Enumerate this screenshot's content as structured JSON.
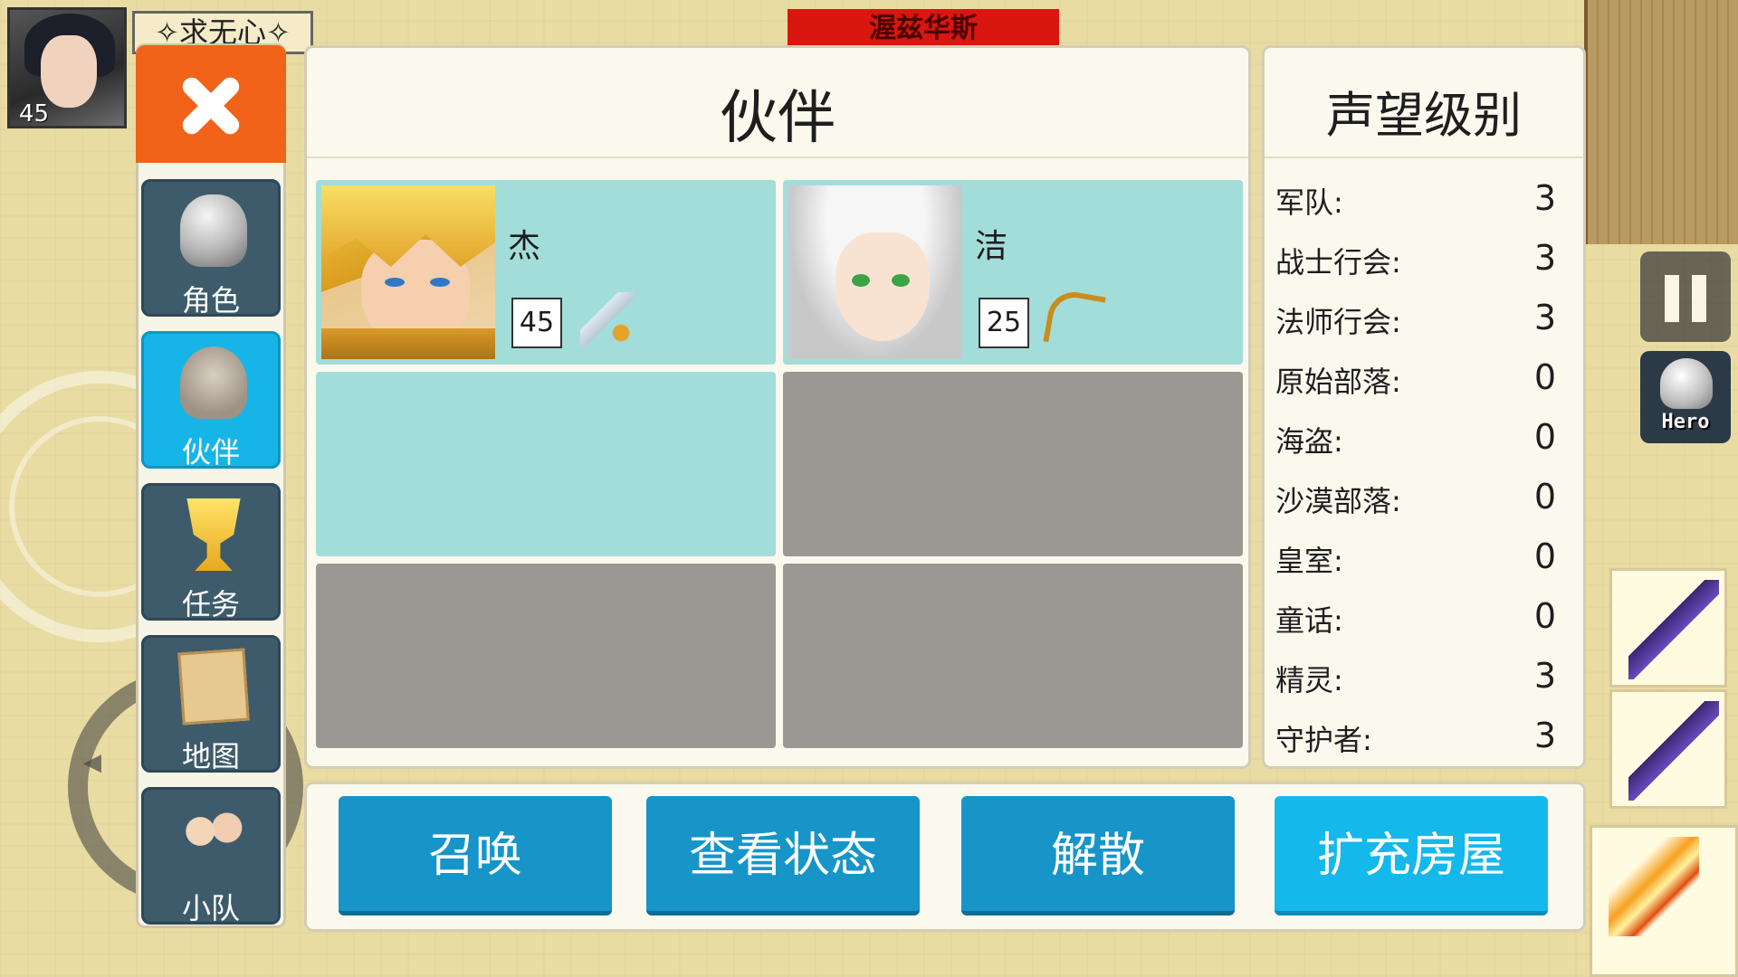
{
  "player": {
    "name": "✧求无心✧",
    "level": "45"
  },
  "boss_banner": "渥兹华斯",
  "sidebar": {
    "items": [
      {
        "label": "角色",
        "icon": "knight-helmet-icon"
      },
      {
        "label": "伙伴",
        "icon": "horned-helmet-icon"
      },
      {
        "label": "任务",
        "icon": "trophy-icon"
      },
      {
        "label": "地图",
        "icon": "map-icon"
      },
      {
        "label": "小队",
        "icon": "party-icon"
      }
    ],
    "active_index": 1
  },
  "companions": {
    "title": "伙伴",
    "slots": [
      {
        "name": "杰",
        "level": "45",
        "weapon": "sword"
      },
      {
        "name": "洁",
        "level": "25",
        "weapon": "bow"
      }
    ]
  },
  "reputation": {
    "title": "声望级别",
    "rows": [
      {
        "label": "军队:",
        "value": "3"
      },
      {
        "label": "战士行会:",
        "value": "3"
      },
      {
        "label": "法师行会:",
        "value": "3"
      },
      {
        "label": "原始部落:",
        "value": "0"
      },
      {
        "label": "海盗:",
        "value": "0"
      },
      {
        "label": "沙漠部落:",
        "value": "0"
      },
      {
        "label": "皇室:",
        "value": "0"
      },
      {
        "label": "童话:",
        "value": "0"
      },
      {
        "label": "精灵:",
        "value": "3"
      },
      {
        "label": "守护者:",
        "value": "3"
      }
    ]
  },
  "actions": {
    "summon": "召唤",
    "view_status": "查看状态",
    "dismiss": "解散",
    "expand_house": "扩充房屋"
  },
  "hud": {
    "hero_label": "Hero"
  },
  "colors": {
    "accent": "#17b4e8",
    "close": "#f06319",
    "slot_filled": "#a3ddda",
    "slot_locked": "#9a9893"
  }
}
